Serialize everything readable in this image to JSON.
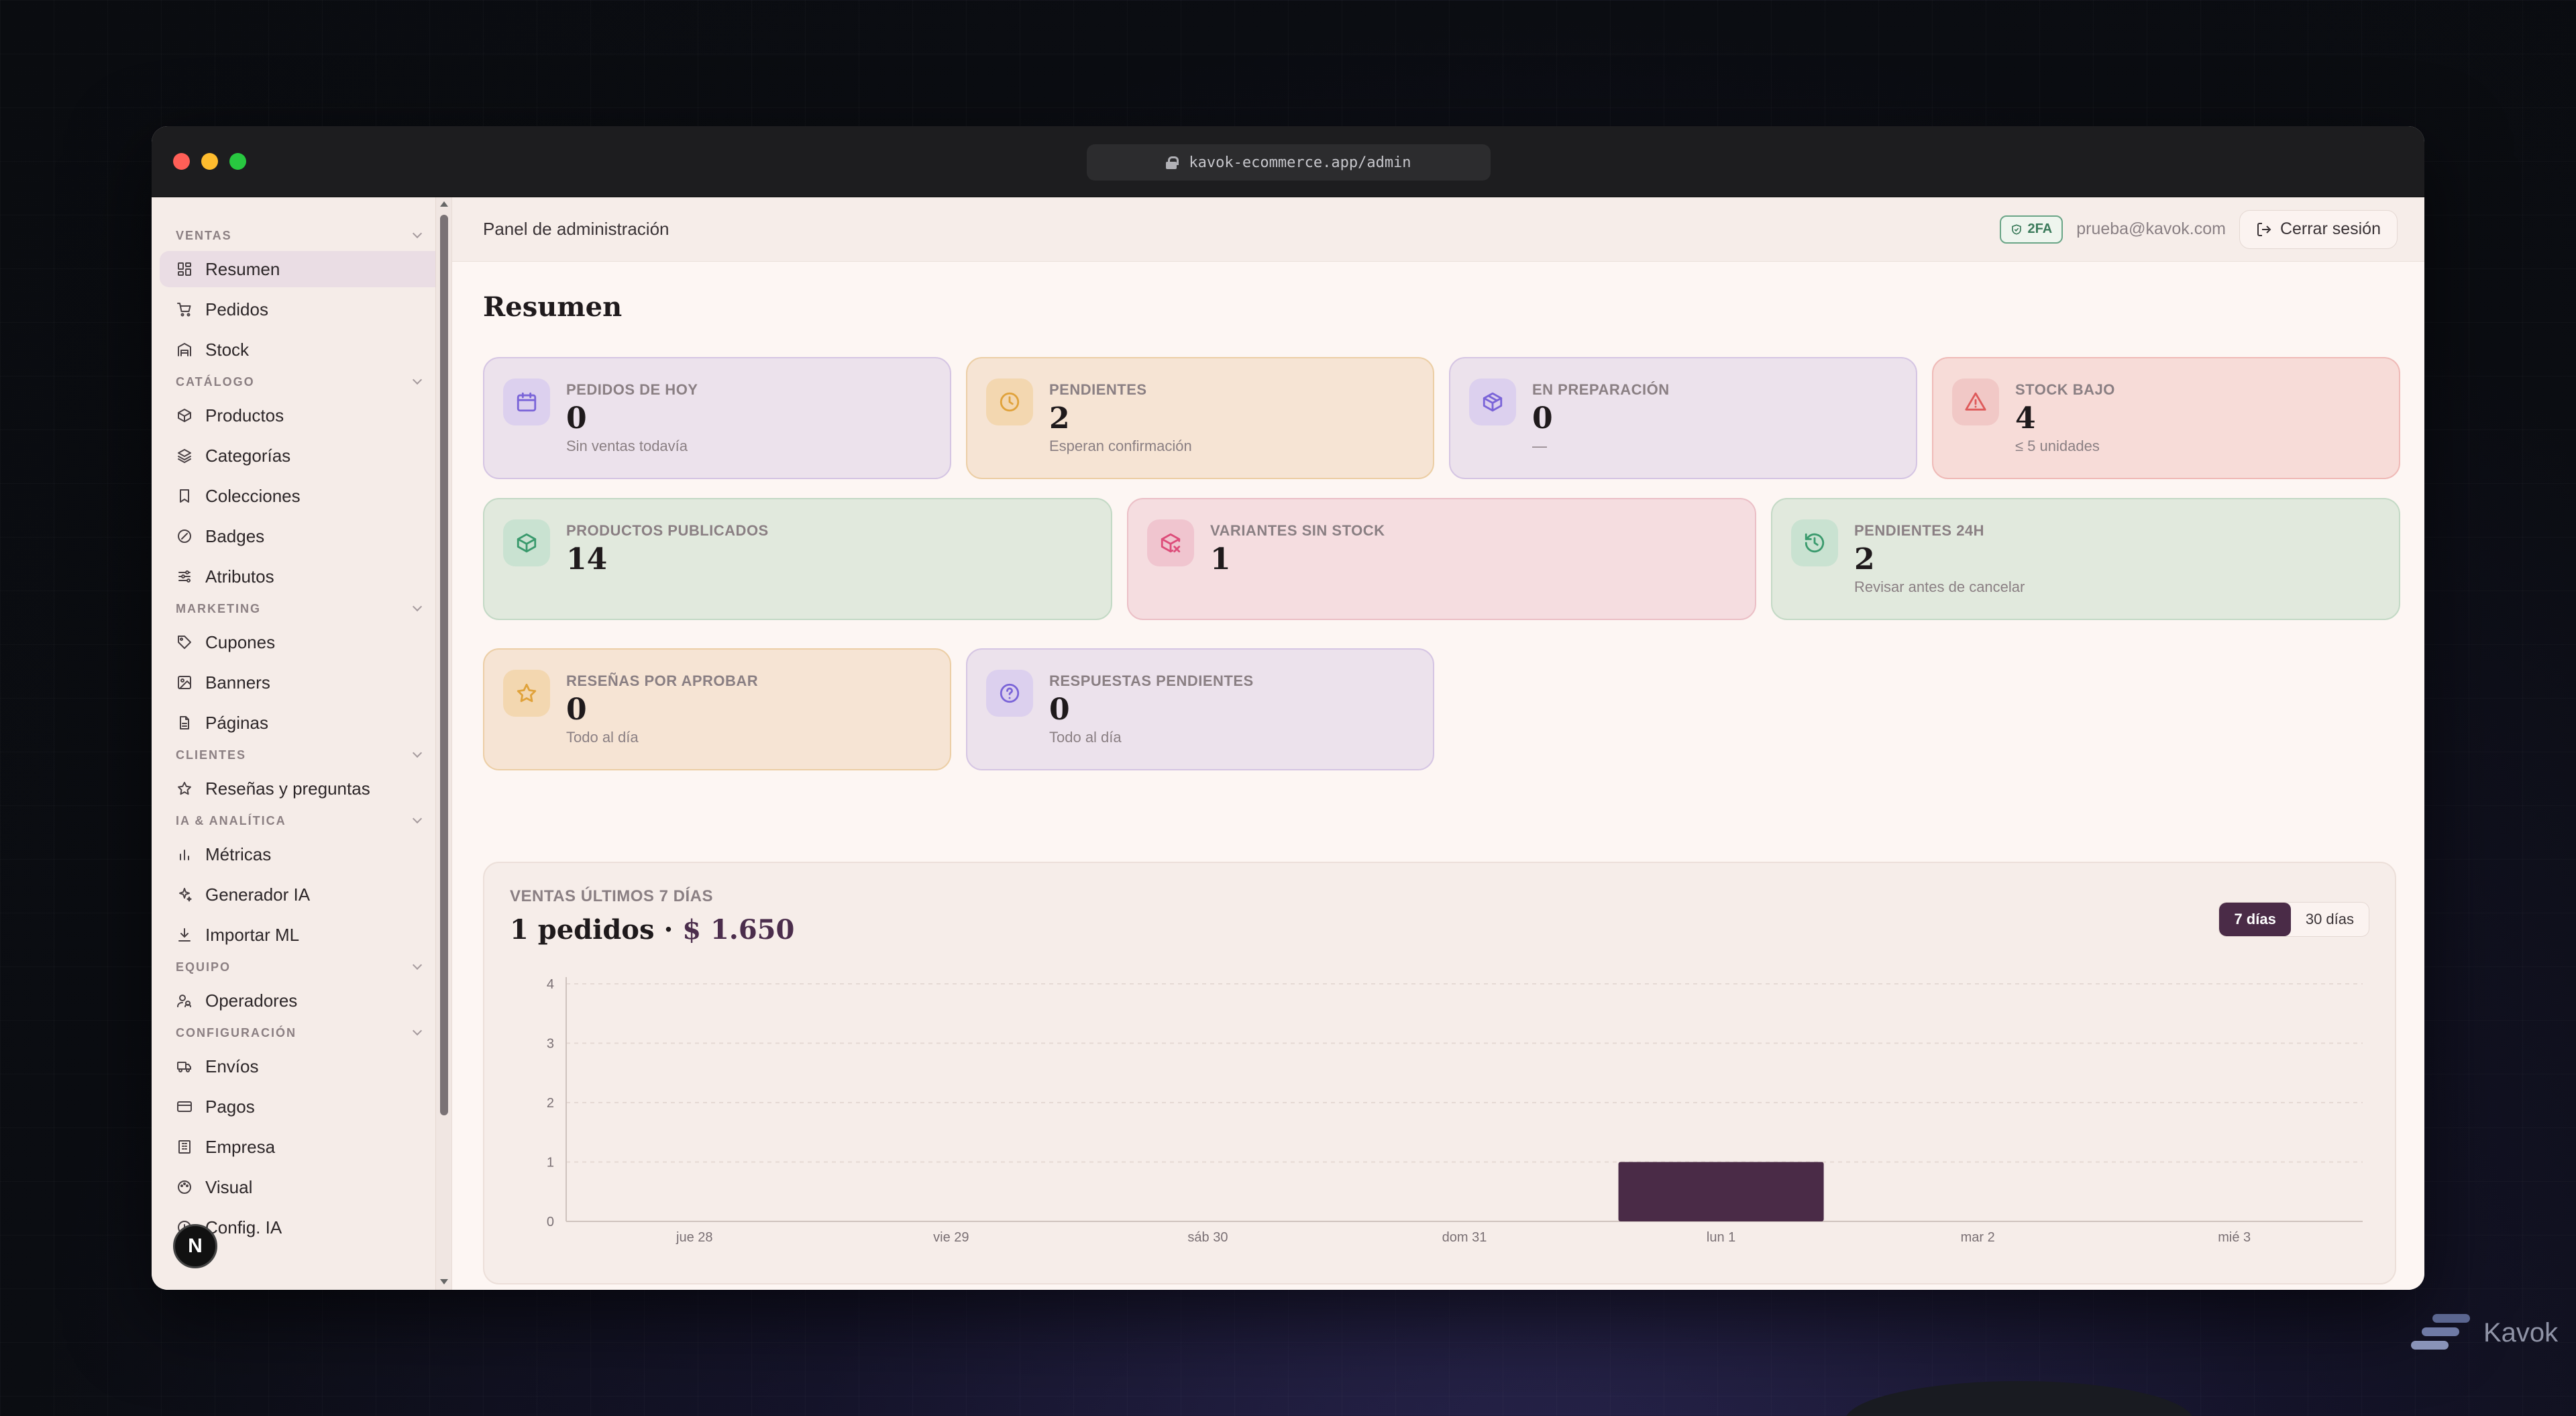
{
  "browser": {
    "url": "kavok-ecommerce.app/admin"
  },
  "sidebar": {
    "groups": [
      {
        "heading": "VENTAS",
        "items": [
          {
            "label": "Resumen",
            "icon": "dashboard-icon",
            "active": true
          },
          {
            "label": "Pedidos",
            "icon": "cart-icon"
          },
          {
            "label": "Stock",
            "icon": "warehouse-icon"
          }
        ]
      },
      {
        "heading": "CATÁLOGO",
        "items": [
          {
            "label": "Productos",
            "icon": "box-icon"
          },
          {
            "label": "Categorías",
            "icon": "layers-icon"
          },
          {
            "label": "Colecciones",
            "icon": "bookmark-icon"
          },
          {
            "label": "Badges",
            "icon": "badge-icon"
          },
          {
            "label": "Atributos",
            "icon": "sliders-icon"
          }
        ]
      },
      {
        "heading": "MARKETING",
        "items": [
          {
            "label": "Cupones",
            "icon": "tag-icon"
          },
          {
            "label": "Banners",
            "icon": "image-icon"
          },
          {
            "label": "Páginas",
            "icon": "file-icon"
          }
        ]
      },
      {
        "heading": "CLIENTES",
        "items": [
          {
            "label": "Reseñas y preguntas",
            "icon": "star-icon"
          }
        ]
      },
      {
        "heading": "IA & ANALÍTICA",
        "items": [
          {
            "label": "Métricas",
            "icon": "bar-chart-icon"
          },
          {
            "label": "Generador IA",
            "icon": "sparkles-icon"
          },
          {
            "label": "Importar ML",
            "icon": "download-icon"
          }
        ]
      },
      {
        "heading": "EQUIPO",
        "items": [
          {
            "label": "Operadores",
            "icon": "users-icon"
          }
        ]
      },
      {
        "heading": "CONFIGURACIÓN",
        "items": [
          {
            "label": "Envíos",
            "icon": "truck-icon"
          },
          {
            "label": "Pagos",
            "icon": "credit-card-icon"
          },
          {
            "label": "Empresa",
            "icon": "building-icon"
          },
          {
            "label": "Visual",
            "icon": "palette-icon"
          },
          {
            "label": "Config. IA",
            "icon": "circle-icon"
          }
        ]
      }
    ]
  },
  "topbar": {
    "title": "Panel de administración",
    "twofa": "2FA",
    "email": "prueba@kavok.com",
    "logout": "Cerrar sesión"
  },
  "page": {
    "title": "Resumen"
  },
  "stats": [
    {
      "label": "PEDIDOS DE HOY",
      "value": "0",
      "sub": "Sin ventas todavía",
      "icon": "calendar-icon",
      "tone": "violet"
    },
    {
      "label": "PENDIENTES",
      "value": "2",
      "sub": "Esperan confirmación",
      "icon": "clock-icon",
      "tone": "amber"
    },
    {
      "label": "EN PREPARACIÓN",
      "value": "0",
      "sub": "—",
      "icon": "package-icon",
      "tone": "violet"
    },
    {
      "label": "STOCK BAJO",
      "value": "4",
      "sub": "≤ 5 unidades",
      "icon": "alert-triangle-icon",
      "tone": "red"
    },
    {
      "label": "PRODUCTOS PUBLICADOS",
      "value": "14",
      "sub": "",
      "icon": "box-icon",
      "tone": "green"
    },
    {
      "label": "VARIANTES SIN STOCK",
      "value": "1",
      "sub": "",
      "icon": "package-x-icon",
      "tone": "pink"
    },
    {
      "label": "PENDIENTES 24H",
      "value": "2",
      "sub": "Revisar antes de cancelar",
      "icon": "history-icon",
      "tone": "green"
    },
    {
      "label": "RESEÑAS POR APROBAR",
      "value": "0",
      "sub": "Todo al día",
      "icon": "star-icon",
      "tone": "amber"
    },
    {
      "label": "RESPUESTAS PENDIENTES",
      "value": "0",
      "sub": "Todo al día",
      "icon": "help-circle-icon",
      "tone": "violet"
    }
  ],
  "sales": {
    "label": "VENTAS ÚLTIMOS 7 DÍAS",
    "orders": "1 pedidos",
    "separator": " · ",
    "amount": "$ 1.650",
    "range_options": [
      "7 días",
      "30 días"
    ],
    "active_range": "7 días"
  },
  "chart_data": {
    "type": "bar",
    "categories": [
      "jue 28",
      "vie 29",
      "sáb 30",
      "dom 31",
      "lun 1",
      "mar 2",
      "mié 3"
    ],
    "values": [
      0,
      0,
      0,
      0,
      1,
      0,
      0
    ],
    "yticks": [
      0,
      1,
      2,
      3,
      4
    ],
    "ylim": [
      0,
      4
    ],
    "grid": true,
    "bar_color": "#4a2b47"
  },
  "colors": {
    "accent": "#4a2b47",
    "twofa": "#3a7a5a"
  },
  "brand": {
    "name": "Kavok"
  },
  "dev_badge": "N"
}
